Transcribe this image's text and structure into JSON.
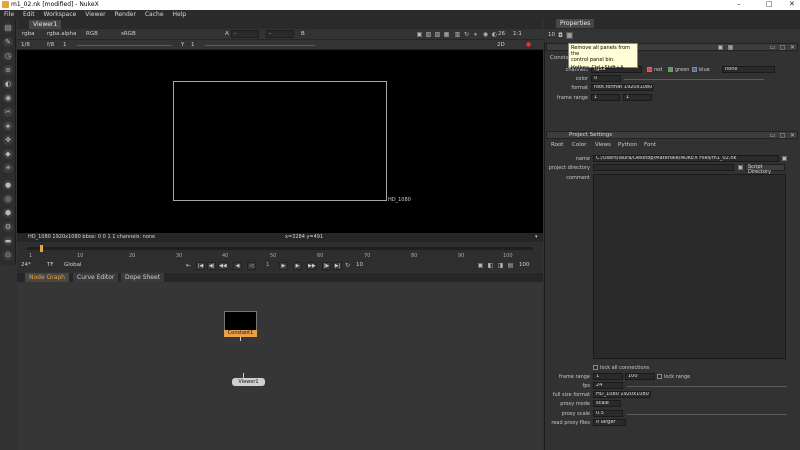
{
  "window": {
    "title": "m1_02.nk [modified] - NukeX",
    "minimize": "–",
    "maximize": "□",
    "close": "✕"
  },
  "menu": [
    "File",
    "Edit",
    "Workspace",
    "Viewer",
    "Render",
    "Cache",
    "Help"
  ],
  "viewer": {
    "tab": "Viewer1",
    "channels": "rgba",
    "alpha": "rgba.alpha",
    "colorspace": "RGB",
    "lut": "sRGB",
    "input_a": "A",
    "input_a_value": "-",
    "input_b_value": "-",
    "input_b": "B",
    "zoom": "26",
    "ratio": "1:1",
    "frame_count": "1/8",
    "frame_label": "f/8",
    "f_value": "1",
    "y_label": "Y",
    "y_value": "1",
    "mode_2d": "2D",
    "format_label": "HD_1080",
    "status_left": "HD_1080 1920x1080  bbox: 0 0 1 1 channels: none",
    "status_coords": "x=3284 y=491"
  },
  "timeline": {
    "ticks": [
      "1",
      "10",
      "20",
      "30",
      "40",
      "50",
      "60",
      "70",
      "80",
      "90",
      "100"
    ],
    "fps": "24*",
    "tf": "TF",
    "global": "Global",
    "frame": "1",
    "step": "10",
    "end_frame": "100"
  },
  "nodegraph": {
    "tabs": [
      "Node Graph",
      "Curve Editor",
      "Dope Sheet"
    ],
    "constant_node": "Constant1",
    "viewer_node": "Viewer1"
  },
  "properties": {
    "tab": "Properties",
    "max_panels": "10",
    "tooltip_line1": "Remove all panels from the",
    "tooltip_line2": "control panel bin.",
    "tooltip_hotkey": "Hotkey: Ctrl+Shift+A",
    "constant_panel": {
      "tab": "Constant",
      "channels_label": "channels",
      "channels_value": "rgba",
      "red": "red",
      "green": "green",
      "blue": "blue",
      "none": "none",
      "color_label": "color",
      "color_value": "0",
      "format_label": "format",
      "format_value": "root.format 1920x1080",
      "frame_range_label": "frame range",
      "frame_range_start": "1",
      "frame_range_end": "1"
    },
    "project_settings": {
      "title": "Project Settings",
      "tabs": [
        "Root",
        "Color",
        "Views",
        "Python",
        "Font"
      ],
      "name_label": "name",
      "name_value": "C:/Users/laura/Desktop/Materiale/NUKEX Files/m1_02.nk",
      "project_dir_label": "project directory",
      "script_dir_button": "Script Directory",
      "comment_label": "comment",
      "lock_connections": "lock all connections",
      "frame_range_label": "frame range",
      "frame_range_start": "1",
      "frame_range_end": "100",
      "lock_range": "lock range",
      "fps_label": "fps",
      "fps_value": "24",
      "full_size_label": "full size format",
      "full_size_value": "HD_1080 1920x1080",
      "proxy_mode_label": "proxy mode",
      "proxy_mode_value": "scale",
      "proxy_scale_label": "proxy scale",
      "proxy_scale_value": "0.5",
      "read_proxy_label": "read proxy files",
      "read_proxy_value": "if larger"
    }
  }
}
